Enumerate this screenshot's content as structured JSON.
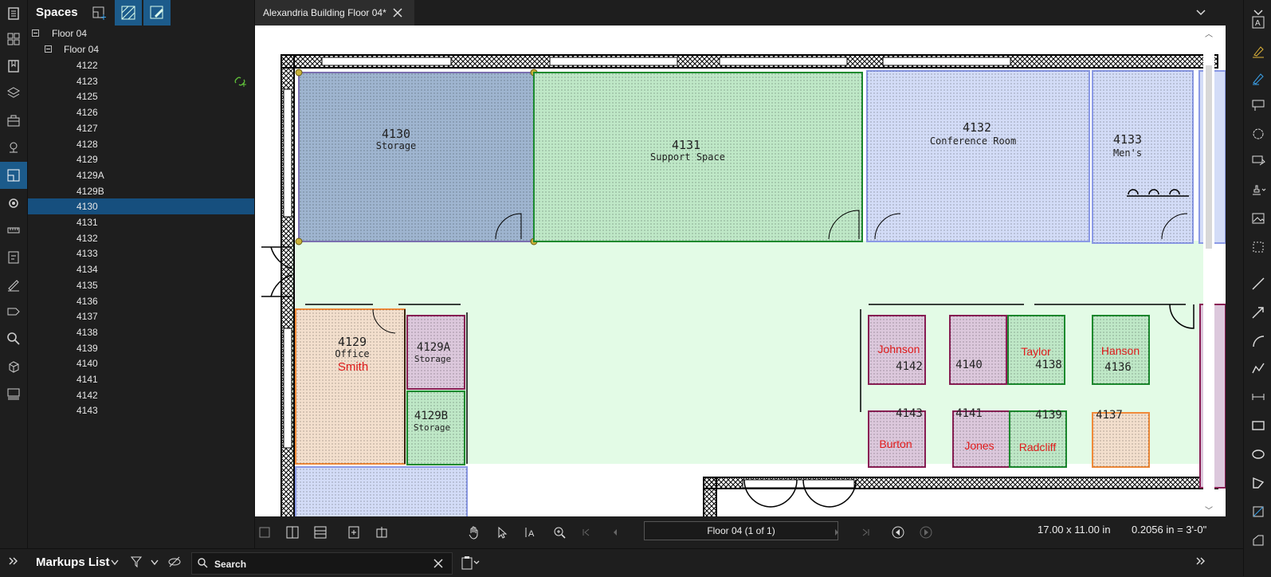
{
  "spaces_panel": {
    "title": "Spaces",
    "tree": {
      "root": "Floor 04",
      "child": "Floor 04",
      "items": [
        "4122",
        "4123",
        "4125",
        "4126",
        "4127",
        "4128",
        "4129",
        "4129A",
        "4129B",
        "4130",
        "4131",
        "4132",
        "4133",
        "4134",
        "4135",
        "4136",
        "4137",
        "4138",
        "4139",
        "4140",
        "4141",
        "4142",
        "4143"
      ],
      "selected": "4130"
    }
  },
  "document_tab": {
    "title": "Alexandria Building Floor 04*"
  },
  "bottom_toolbar": {
    "page_indicator": "Floor 04 (1 of 1)",
    "page_size": "17.00 x 11.00 in",
    "scale": "0.2056 in = 3'-0\""
  },
  "markups_bar": {
    "title": "Markups List",
    "search_placeholder": "Search"
  },
  "floorplan": {
    "rooms": [
      {
        "number": "4130",
        "name": "Storage",
        "fill": "#9fb5d0",
        "stroke": "#7a6fb0"
      },
      {
        "number": "4131",
        "name": "Support Space",
        "fill": "#bfe8c7",
        "stroke": "#1b8a2e"
      },
      {
        "number": "4132",
        "name": "Conference Room",
        "fill": "#d3dcf7",
        "stroke": "#8b9ae6"
      },
      {
        "number": "4133",
        "name": "Men's",
        "fill": "#d3dcf7",
        "stroke": "#8b9ae6"
      },
      {
        "number": "4129",
        "name": "Office",
        "occupant": "Smith",
        "fill": "#f3dfcd",
        "stroke": "#f08a3a"
      },
      {
        "number": "4129A",
        "name": "Storage",
        "fill": "#dcc8dc",
        "stroke": "#8a1f55"
      },
      {
        "number": "4129B",
        "name": "Storage",
        "fill": "#bfe8c7",
        "stroke": "#1b8a2e"
      }
    ],
    "cubicles": [
      {
        "number": "4142",
        "occupant": "Johnson",
        "fill": "#dcc8dc",
        "stroke": "#8a1f55"
      },
      {
        "number": "4140",
        "occupant": "",
        "fill": "#dcc8dc",
        "stroke": "#8a1f55"
      },
      {
        "number": "4138",
        "occupant": "Taylor",
        "fill": "#bfe8c7",
        "stroke": "#1b8a2e"
      },
      {
        "number": "4136",
        "occupant": "Hanson",
        "fill": "#bfe8c7",
        "stroke": "#1b8a2e"
      },
      {
        "number": "4143",
        "occupant": "Burton",
        "fill": "#dcc8dc",
        "stroke": "#8a1f55"
      },
      {
        "number": "4141",
        "occupant": "Jones",
        "fill": "#dcc8dc",
        "stroke": "#8a1f55"
      },
      {
        "number": "4139",
        "occupant": "Radcliff",
        "fill": "#bfe8c7",
        "stroke": "#1b8a2e"
      },
      {
        "number": "4137",
        "occupant": "",
        "fill": "#f3dfcd",
        "stroke": "#f08a3a"
      }
    ],
    "corridor_fill": "#e3fbe6",
    "occupant_color": "#e01b1b"
  },
  "colors": {
    "accent": "#1c5b8b",
    "selected_row": "#164f7e"
  }
}
